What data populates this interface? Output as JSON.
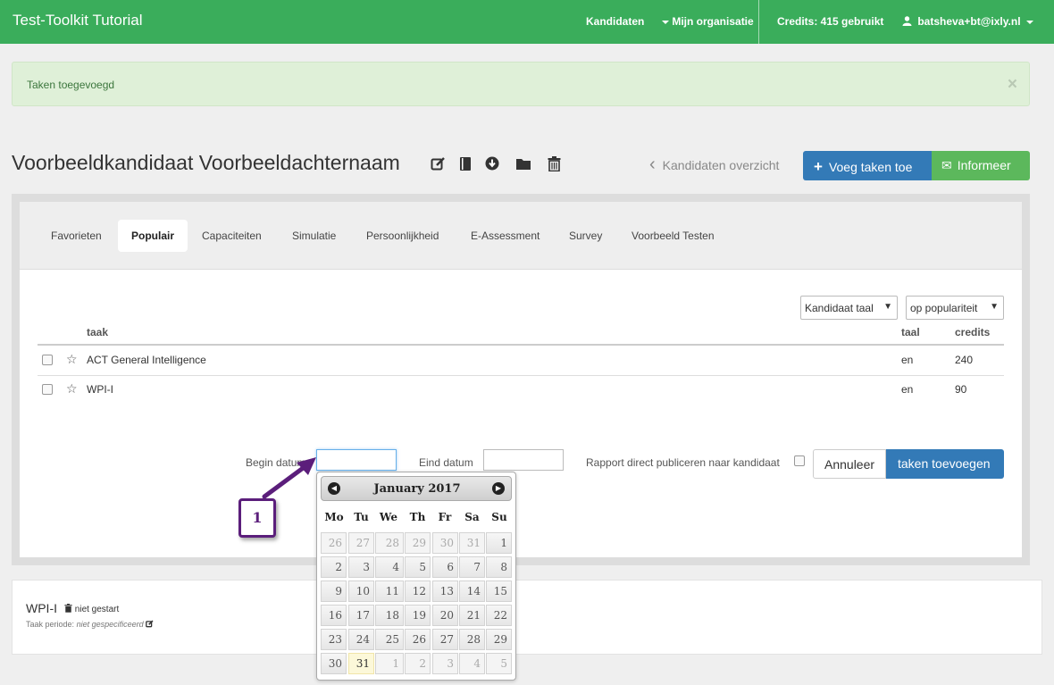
{
  "navbar": {
    "brand": "Test-Toolkit Tutorial",
    "items": [
      "Kandidaten",
      "Mijn organisatie",
      "Credits: 415 gebruikt",
      "batsheva+bt@ixly.nl"
    ],
    "bg_color": "#3aad5b"
  },
  "alert": {
    "text": "Taken toegevoegd",
    "close": "×"
  },
  "candidate": {
    "name": "Voorbeeldkandidaat Voorbeeldachternaam",
    "icons": [
      "edit-icon",
      "book-icon",
      "download-icon",
      "folder-icon",
      "trash-icon"
    ]
  },
  "header_actions": {
    "back_arrow": "‹",
    "back_link": "Kandidaten overzicht",
    "add_tasks_icon": "+",
    "add_tasks": "Voeg taken toe",
    "inform_icon": "✉",
    "inform": "Informeer"
  },
  "tabs": [
    {
      "label": "Favorieten",
      "active": false
    },
    {
      "label": "Populair",
      "active": true
    },
    {
      "label": "Capaciteiten",
      "active": false
    },
    {
      "label": "Simulatie",
      "active": false
    },
    {
      "label": "Persoonlijkheid",
      "active": false
    },
    {
      "label": "E-Assessment",
      "active": false
    },
    {
      "label": "Survey",
      "active": false
    },
    {
      "label": "Voorbeeld Testen",
      "active": false
    }
  ],
  "filters": {
    "language_select": "Kandidaat taal",
    "sort_select": "op populariteit"
  },
  "table": {
    "headers": {
      "task": "taak",
      "lang": "taal",
      "credits": "credits"
    },
    "rows": [
      {
        "name": "ACT General Intelligence",
        "lang": "en",
        "credits": "240"
      },
      {
        "name": "WPI-I",
        "lang": "en",
        "credits": "90"
      }
    ]
  },
  "form": {
    "begin_label": "Begin datum",
    "end_label": "Eind datum",
    "publish_label": "Rapport direct publiceren naar kandidaat",
    "cancel": "Annuleer",
    "submit": "taken toevoegen"
  },
  "datepicker": {
    "title": "January 2017",
    "prev": "◀",
    "next": "▶",
    "weekdays": [
      "Mo",
      "Tu",
      "We",
      "Th",
      "Fr",
      "Sa",
      "Su"
    ],
    "weeks": [
      [
        "26",
        "27",
        "28",
        "29",
        "30",
        "31",
        "1"
      ],
      [
        "2",
        "3",
        "4",
        "5",
        "6",
        "7",
        "8"
      ],
      [
        "9",
        "10",
        "11",
        "12",
        "13",
        "14",
        "15"
      ],
      [
        "16",
        "17",
        "18",
        "19",
        "20",
        "21",
        "22"
      ],
      [
        "23",
        "24",
        "25",
        "26",
        "27",
        "28",
        "29"
      ],
      [
        "30",
        "31",
        "1",
        "2",
        "3",
        "4",
        "5"
      ]
    ],
    "today": "31"
  },
  "assigned_task": {
    "name": "WPI-I",
    "status": "niet gestart",
    "period_label": "Taak periode:",
    "period_value": "niet gespecificeerd"
  },
  "callout": {
    "number": "1",
    "color": "#5b1e7b"
  }
}
